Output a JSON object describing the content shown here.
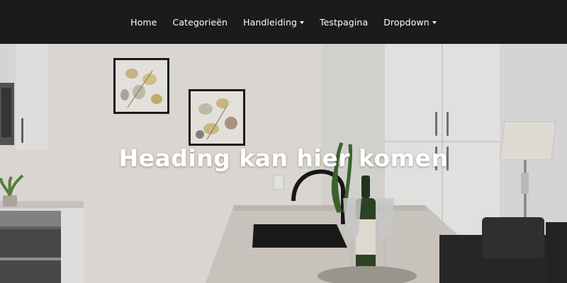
{
  "navbar": {
    "items": [
      {
        "label": "Home",
        "has_dropdown": false
      },
      {
        "label": "Categorieën",
        "has_dropdown": false
      },
      {
        "label": "Handleiding",
        "has_dropdown": true
      },
      {
        "label": "Testpagina",
        "has_dropdown": false
      },
      {
        "label": "Dropdown",
        "has_dropdown": true
      }
    ],
    "background_color": "#1b1b1b",
    "text_color": "#ffffff"
  },
  "hero": {
    "heading": "Heading kan hier komen",
    "image_alt": "kitchen-interior-photo"
  }
}
